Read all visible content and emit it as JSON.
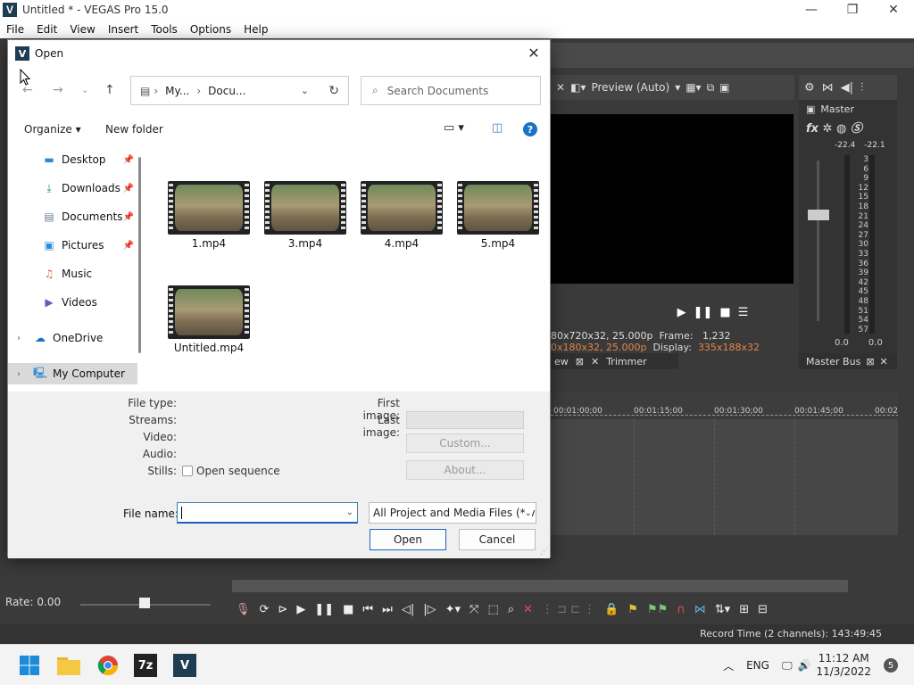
{
  "app": {
    "title": "Untitled * - VEGAS Pro 15.0",
    "logo_letter": "V",
    "window_controls": [
      "—",
      "❐",
      "✕"
    ],
    "menu": [
      "File",
      "Edit",
      "View",
      "Insert",
      "Tools",
      "Options",
      "Help"
    ]
  },
  "preview": {
    "quality": "Preview (Auto)",
    "info_line1": "80x720x32, 25.000p",
    "frame_label": "Frame:",
    "frame_value": "1,232",
    "info_line2": "0x180x32, 25.000p",
    "display_label": "Display:",
    "display_value": "335x188x32",
    "tab_left": "ew",
    "tab_trimmer": "Trimmer"
  },
  "mixer": {
    "master_label": "Master",
    "level_left": "-22.4",
    "level_right": "-22.1",
    "scale": [
      "3",
      "6",
      "9",
      "12",
      "15",
      "18",
      "21",
      "24",
      "27",
      "30",
      "33",
      "36",
      "39",
      "42",
      "45",
      "48",
      "51",
      "54",
      "57"
    ],
    "bottom_left": "0.0",
    "bottom_right": "0.0",
    "tab_label": "Master Bus"
  },
  "timeline": {
    "ticks": [
      "00:01:00;00",
      "00:01:15;00",
      "00:01:30;00",
      "00:01:45;00",
      "00:02"
    ],
    "rate": "Rate: 0.00",
    "record_time": "Record Time (2 channels): 143:49:45"
  },
  "dialog": {
    "title": "Open",
    "close": "✕",
    "breadcrumb": [
      "My...",
      "Docu..."
    ],
    "search_placeholder": "Search Documents",
    "organize": "Organize",
    "new_folder": "New folder",
    "help": "?",
    "nav_items": [
      {
        "label": "Desktop",
        "icon": "desktop-icon",
        "pinned": true
      },
      {
        "label": "Downloads",
        "icon": "download-icon",
        "pinned": true
      },
      {
        "label": "Documents",
        "icon": "documents-icon",
        "pinned": true
      },
      {
        "label": "Pictures",
        "icon": "pictures-icon",
        "pinned": true
      },
      {
        "label": "Music",
        "icon": "music-icon",
        "pinned": false
      },
      {
        "label": "Videos",
        "icon": "videos-icon",
        "pinned": false
      },
      {
        "label": "OneDrive",
        "icon": "onedrive-icon",
        "pinned": false
      },
      {
        "label": "My Computer",
        "icon": "computer-icon",
        "pinned": false
      }
    ],
    "files": [
      "1.mp4",
      "3.mp4",
      "4.mp4",
      "5.mp4",
      "Untitled.mp4"
    ],
    "details": {
      "file_type": "File type:",
      "streams": "Streams:",
      "video": "Video:",
      "audio": "Audio:",
      "stills": "Stills:",
      "open_sequence": "Open sequence",
      "first_image": "First image:",
      "last_image": "Last image:",
      "custom": "Custom...",
      "about": "About..."
    },
    "file_name_label": "File name:",
    "file_name_value": "",
    "filter": "All Project and Media Files (*.ve",
    "open_button": "Open",
    "cancel_button": "Cancel"
  },
  "taskbar": {
    "language": "ENG",
    "time": "11:12 AM",
    "date": "11/3/2022",
    "notifications": "5",
    "app_7z": "7z",
    "app_vegas": "V"
  }
}
